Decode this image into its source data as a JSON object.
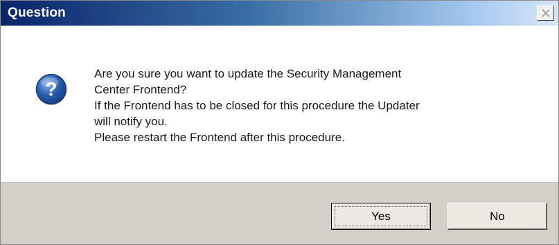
{
  "window": {
    "title": "Question"
  },
  "message": {
    "lines": [
      "Are you sure you want to update the Security Management",
      "Center Frontend?",
      "If the Frontend has to be closed for this procedure the Updater",
      "will notify you.",
      "Please restart the Frontend after this procedure."
    ]
  },
  "icon": {
    "name": "question-icon",
    "glyph": "?",
    "color": "#2a5caa"
  },
  "buttons": {
    "yes_label": "Yes",
    "no_label": "No",
    "default": "yes"
  },
  "colors": {
    "titlebar_start": "#0a246a",
    "titlebar_end": "#d8e6f5",
    "footer_background": "#d4d0c8"
  }
}
